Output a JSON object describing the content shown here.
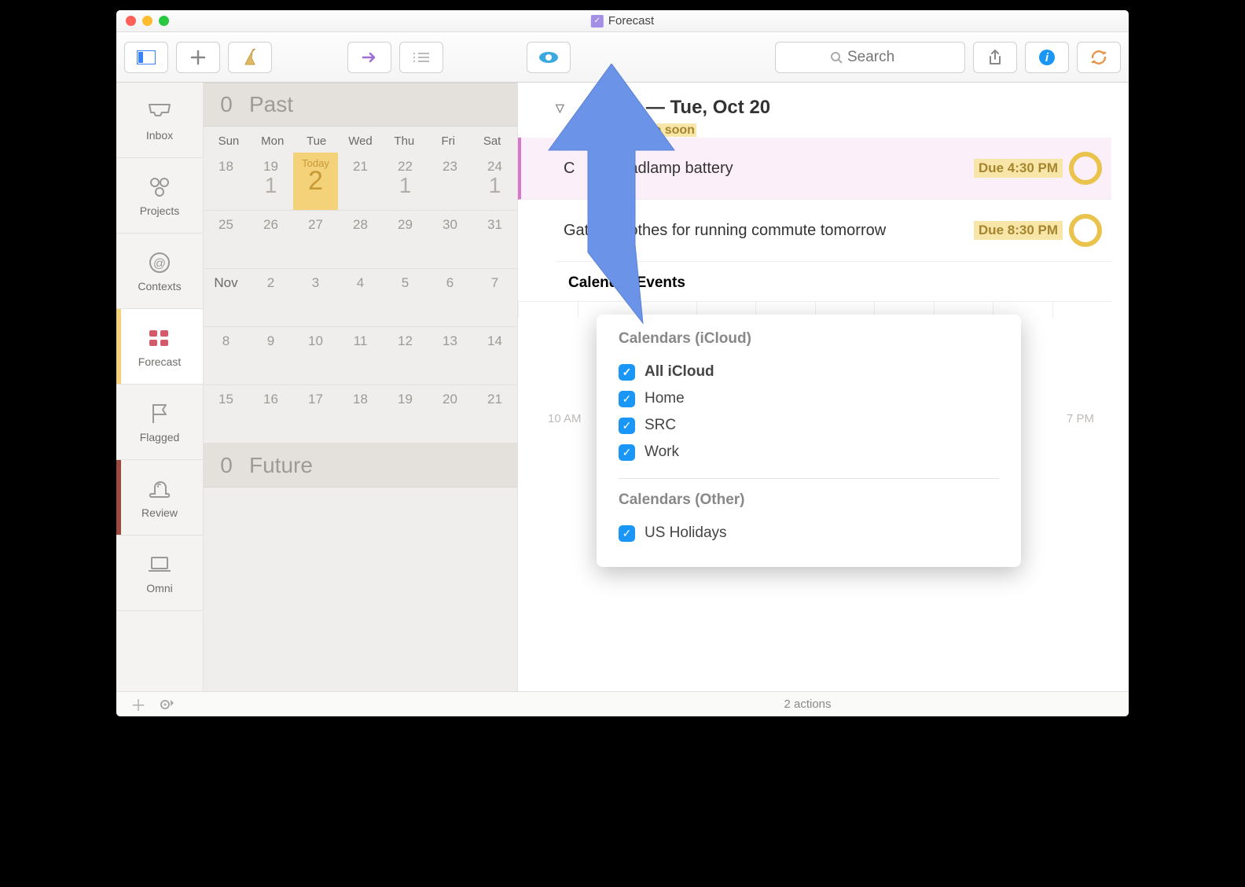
{
  "window": {
    "title": "Forecast"
  },
  "toolbar": {
    "search_placeholder": "Search"
  },
  "sidebar": {
    "items": [
      {
        "label": "Inbox"
      },
      {
        "label": "Projects"
      },
      {
        "label": "Contexts"
      },
      {
        "label": "Forecast"
      },
      {
        "label": "Flagged"
      },
      {
        "label": "Review"
      },
      {
        "label": "Omni"
      }
    ]
  },
  "forecast": {
    "past_label": "Past",
    "past_count": "0",
    "future_label": "Future",
    "future_count": "0",
    "day_headers": [
      "Sun",
      "Mon",
      "Tue",
      "Wed",
      "Thu",
      "Fri",
      "Sat"
    ],
    "today_label": "Today",
    "rows": [
      [
        "18",
        "19",
        "TODAY",
        "21",
        "22",
        "23",
        "24"
      ],
      [
        "25",
        "26",
        "27",
        "28",
        "29",
        "30",
        "31"
      ],
      [
        "Nov",
        "2",
        "3",
        "4",
        "5",
        "6",
        "7"
      ],
      [
        "8",
        "9",
        "10",
        "11",
        "12",
        "13",
        "14"
      ],
      [
        "15",
        "16",
        "17",
        "18",
        "19",
        "20",
        "21"
      ]
    ],
    "today_daynum": "2",
    "counts": {
      "r0c1": "1",
      "r0c4": "1",
      "r0c6": "1"
    }
  },
  "content": {
    "heading_suffix": "— Tue, Oct 20",
    "subtext_suffix": "s •",
    "due_soon": "2 due soon",
    "tasks": [
      {
        "title_prefix": "C",
        "title_suffix": "e headlamp battery",
        "due": "Due 4:30 PM"
      },
      {
        "title_prefix": "Gath",
        "title_suffix": " clothes for running commute tomorrow",
        "due": "Due 8:30 PM"
      }
    ],
    "calendar_events_label": "Calendar Events",
    "time_left": "10 AM",
    "time_right": "7 PM"
  },
  "popover": {
    "group1_title": "Calendars (iCloud)",
    "group1_items": [
      "All iCloud",
      "Home",
      "SRC",
      "Work"
    ],
    "group2_title": "Calendars (Other)",
    "group2_items": [
      "US Holidays"
    ]
  },
  "statusbar": {
    "actions": "2 actions"
  }
}
